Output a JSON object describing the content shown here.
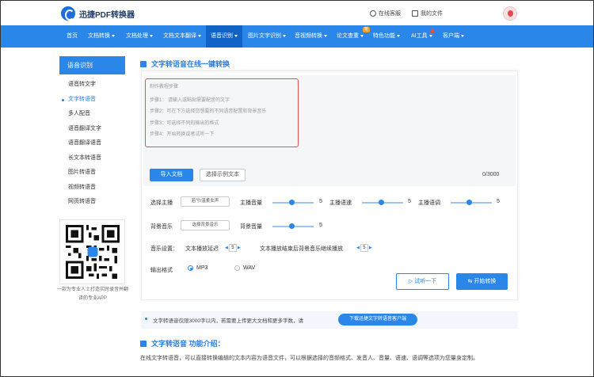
{
  "header": {
    "logo_text": "迅捷PDF转换器",
    "online_service": "在线客服",
    "my_files": "我的文件"
  },
  "nav": {
    "items": [
      {
        "label": "首页"
      },
      {
        "label": "文档转换"
      },
      {
        "label": "文档处理"
      },
      {
        "label": "文档文本翻译"
      },
      {
        "label": "语音识别"
      },
      {
        "label": "图片文字识别"
      },
      {
        "label": "音视频转换"
      },
      {
        "label": "论文查重"
      },
      {
        "label": "特色功能"
      },
      {
        "label": "AI工具"
      },
      {
        "label": "客户端"
      }
    ],
    "new_badge": "新"
  },
  "sidebar": {
    "header": "语音识别",
    "items": [
      {
        "label": "语音转文字"
      },
      {
        "label": "文字转语音"
      },
      {
        "label": "多人配音"
      },
      {
        "label": "语音翻译文字"
      },
      {
        "label": "语音翻译语音"
      },
      {
        "label": "长文本转语音"
      },
      {
        "label": "图片转语音"
      },
      {
        "label": "视频转语音"
      },
      {
        "label": "网页转语音"
      }
    ],
    "qr_caption": "一款为专业人士打造实时录音并翻译的专业APP"
  },
  "main": {
    "title": "文字转语音在线一键转换",
    "hint": {
      "heading": "制作教程步骤",
      "step1": "步骤1：   请输入或粘贴需要配音的文字",
      "step2": "步骤2：可在下方选择您想要的不同语音配置和背景音乐",
      "step3": "步骤3：可选择不同的输出的格式",
      "step4": "步骤4：开始转换或者试听一下"
    },
    "import_button": "导入文档",
    "sample_button": "选择示例文本",
    "counter": "0/3000",
    "controls": {
      "anchor_label": "选择主播",
      "anchor_value": "若兮/温柔女声",
      "volume_label": "主播音量",
      "volume_value": "5",
      "speed_label": "主播语速",
      "speed_value": "5",
      "pitch_label": "主播语调",
      "pitch_value": "5",
      "bgm_label": "背景音乐",
      "bgm_button": "选择背景音乐",
      "bgm_volume_label": "背景音量",
      "bgm_volume_value": "5",
      "music_settings_label": "音乐设置：",
      "delay_label": "文本播放延迟",
      "delay_value": "5",
      "continue_label": "文本播放结束后背景音乐继续播放",
      "continue_value": "5",
      "output_label": "输出格式",
      "format_mp3": "MP3",
      "format_wav": "WAV"
    },
    "listen_button": "试听一下",
    "start_button": "开始转换",
    "notice_text": "文字转语音仅限3000字以内，若需要上传更大文档和更多字数，请",
    "notice_button": "下载迅捷文字转语音客户端",
    "intro_title": "文字转语音 功能介绍：",
    "intro_text": "在线文字转语音，可以直接转换编辑的文本内容为语音文件，可以根据选择的音频格式、发音人、音量、语速、语调等选项为您量身定制。"
  },
  "colors": {
    "accent": "#2b86e9",
    "nav_active": "#1263c7",
    "hint_border": "#e2574a"
  }
}
